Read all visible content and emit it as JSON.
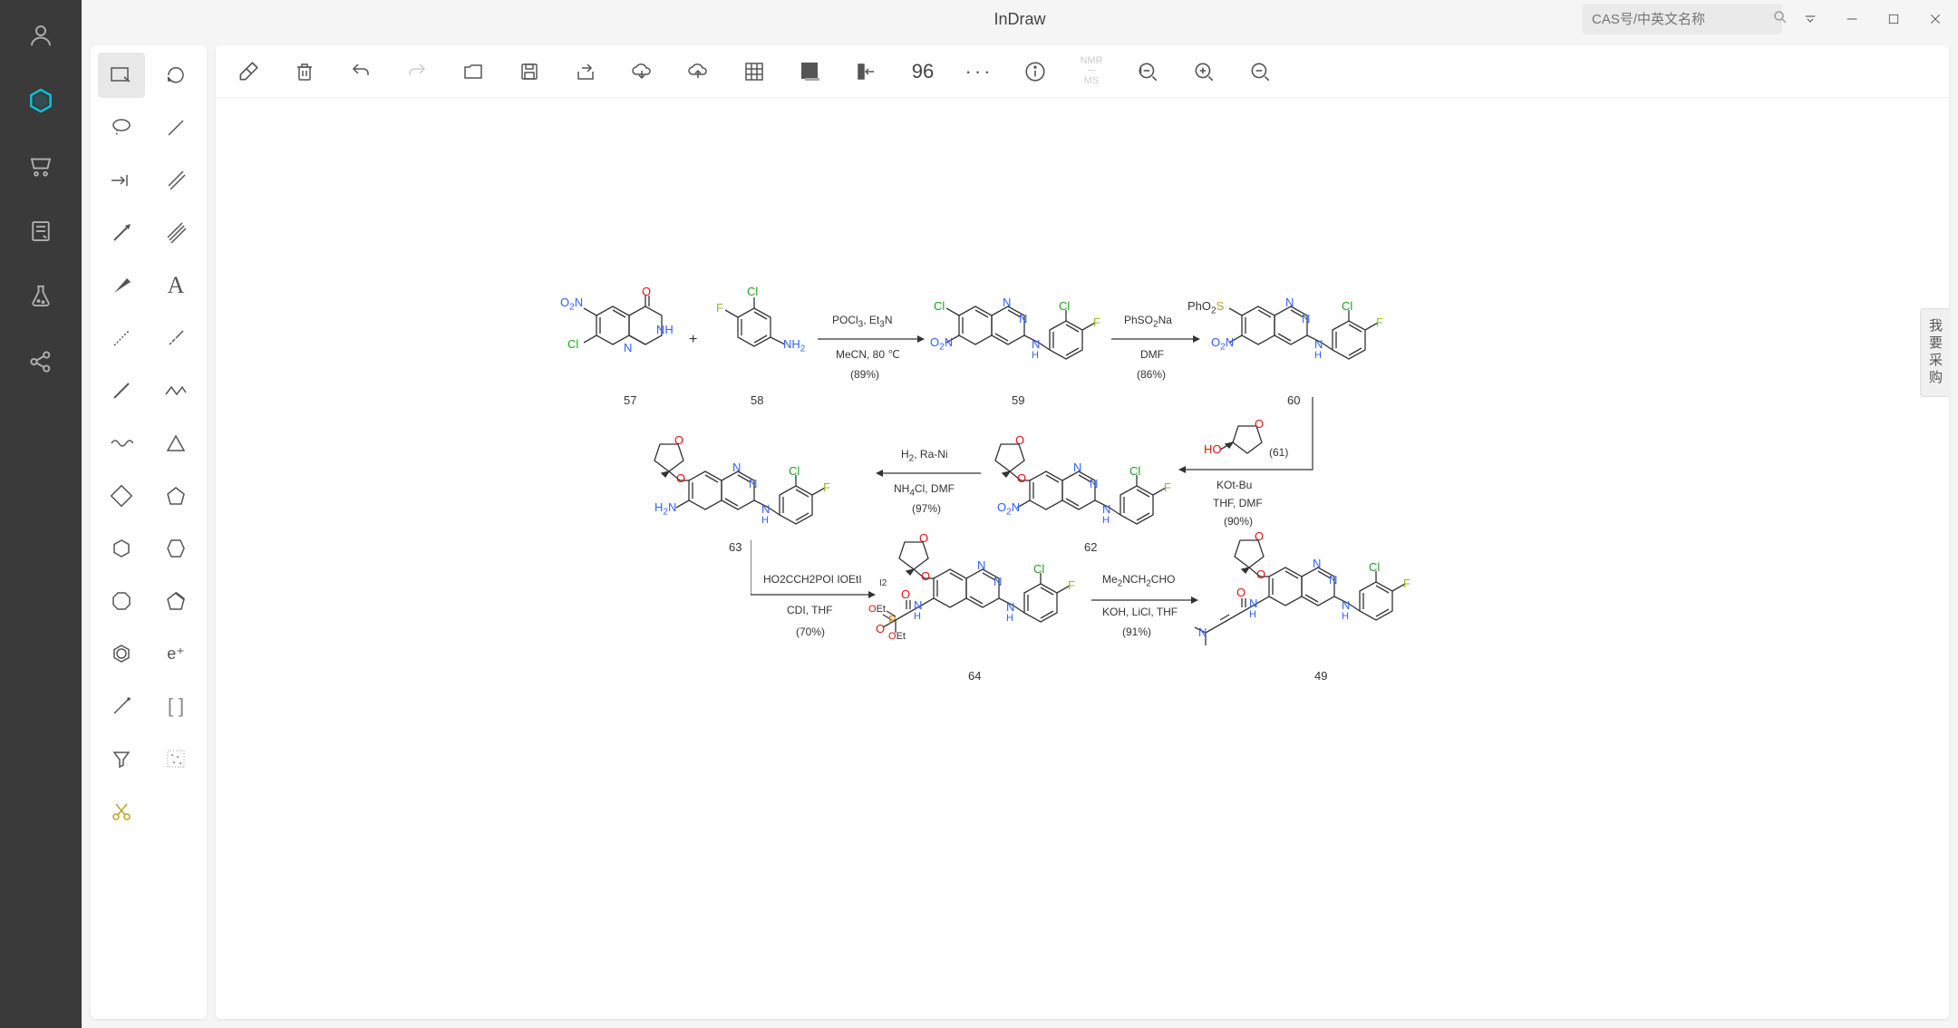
{
  "app": {
    "title": "InDraw"
  },
  "search": {
    "placeholder": "CAS号/中英文名称"
  },
  "side_tab": "我要采购",
  "toolbar": {
    "resolution": "96"
  },
  "reactions": {
    "r1": {
      "line1": "POCl₃, Et₃N",
      "line2": "MeCN, 80 ℃",
      "yield": "(89%)"
    },
    "r2": {
      "line1": "PhSO₂Na",
      "line2": "DMF",
      "yield": "(86%)"
    },
    "r3": {
      "line1": "KOt-Bu",
      "line2": "THF, DMF",
      "yield": "(90%)",
      "reagent_num": "(61)"
    },
    "r4": {
      "line1": "H₂, Ra-Ni",
      "line2": "NH₄Cl, DMF",
      "yield": "(97%)"
    },
    "r5": {
      "line1": "HO2CCH2POI   IOEtI",
      "sub": "I2",
      "line2": "CDI, THF",
      "yield": "(70%)"
    },
    "r6": {
      "line1": "Me₂NCH₂CHO",
      "line2": "KOH, LiCl, THF",
      "yield": "(91%)"
    }
  },
  "compounds": {
    "c57": "57",
    "c58": "58",
    "c59": "59",
    "c60": "60",
    "c61": "61",
    "c62": "62",
    "c63": "63",
    "c64": "64",
    "c49": "49"
  },
  "atoms": {
    "O2N": "O₂N",
    "NO2": "NO₂",
    "Cl": "Cl",
    "F": "F",
    "N": "N",
    "NH": "NH",
    "NH2": "NH₂",
    "O": "O",
    "HN": "HN",
    "PhO2S": "PhO₂S",
    "HO": "HO",
    "H2N": "H₂N",
    "H": "H",
    "OEt": "OEt",
    "P": "P"
  }
}
